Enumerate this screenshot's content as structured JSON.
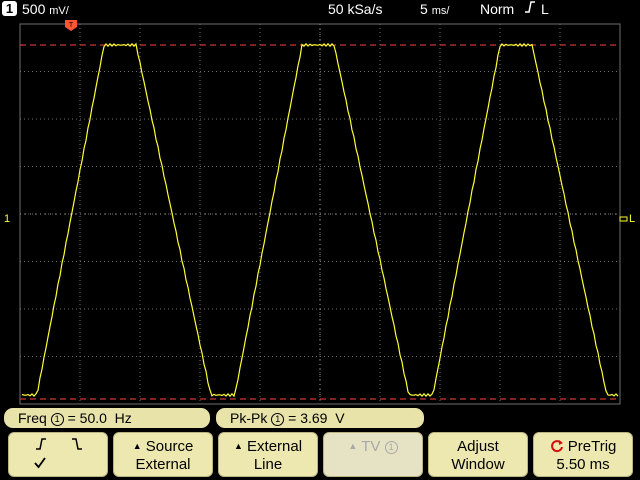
{
  "status": {
    "channel": "1",
    "volts_per_div": "500",
    "volts_unit": "mV/",
    "sample_rate": "50 kSa/s",
    "time_per_div": "5",
    "time_unit": "ms/",
    "trigger_mode": "Norm",
    "trigger_slope_icon": "rising-edge-icon",
    "trigger_source": "L"
  },
  "screen": {
    "ch1_marker": "1",
    "trigger_level_marker": "L",
    "trace_color": "#ffff33",
    "grid_color": "#6e6e6e",
    "cursor_color": "#ff4444"
  },
  "measurements": {
    "freq_label": "Freq",
    "freq_channel": "1",
    "freq_value": "50.0  Hz",
    "pkpk_label": "Pk-Pk",
    "pkpk_channel": "1",
    "pkpk_value": "3.69  V"
  },
  "softkeys": {
    "slope": {
      "selected_icon": "check-icon"
    },
    "source": {
      "line1": "Source",
      "line2": "External"
    },
    "external": {
      "line1": "External",
      "line2": "Line"
    },
    "tv": {
      "line1": "TV",
      "channel": "1"
    },
    "adjust": {
      "line1": "Adjust",
      "line2": "Window"
    },
    "pretrig": {
      "line1": "PreTrig",
      "line2": "5.50 ms"
    }
  }
}
